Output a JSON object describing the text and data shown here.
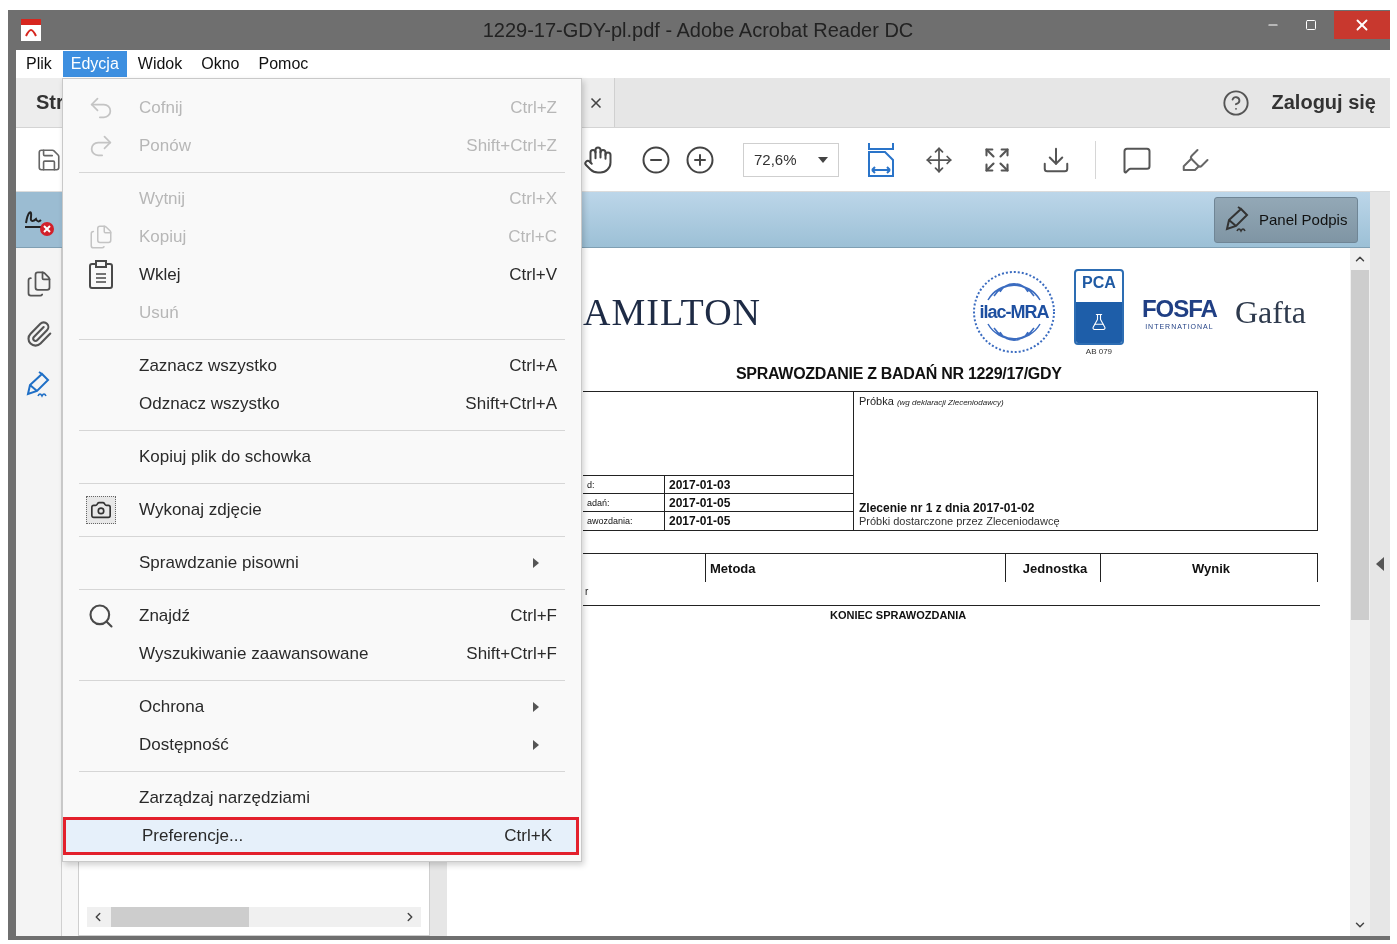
{
  "window": {
    "title": "1229-17-GDY-pl.pdf - Adobe Acrobat Reader DC"
  },
  "menu_bar": [
    {
      "label": "Plik",
      "selected": false
    },
    {
      "label": "Edycja",
      "selected": true
    },
    {
      "label": "Widok",
      "selected": false
    },
    {
      "label": "Okno",
      "selected": false
    },
    {
      "label": "Pomoc",
      "selected": false
    }
  ],
  "tab": {
    "label": "Str"
  },
  "account": {
    "label": "Zaloguj się"
  },
  "toolbar": {
    "zoom": "72,6%"
  },
  "sign_bar": {
    "button": "Panel Podpis"
  },
  "document": {
    "company": "AMILTON",
    "logos": [
      {
        "kind": "ilac",
        "text": "ilac-MRA"
      },
      {
        "kind": "pca",
        "text": "PCA",
        "caption": "AB 079"
      },
      {
        "kind": "fosfa",
        "text": "FOSFA",
        "subtitle": "INTERNATIONAL"
      },
      {
        "kind": "gafta",
        "text": "Gafta"
      }
    ],
    "title": "SPRAWOZDANIE Z BADAŃ NR 1229/17/GDY",
    "info_rows": [
      {
        "label": "d:",
        "value": "2017-01-03"
      },
      {
        "label": "adań:",
        "value": "2017-01-05"
      },
      {
        "label": "awozdania:",
        "value": "2017-01-05"
      }
    ],
    "sample_label": "Próbka",
    "sample_note": "(wg deklaracji Zleceniodawcy)",
    "order": "Zlecenie nr 1 z dnia 2017-01-02",
    "delivery": "Próbki dostarczone przez Zleceniodawcę",
    "results_columns": [
      "Metoda",
      "Jednostka",
      "Wynik"
    ],
    "results_row": "r",
    "end": "KONIEC SPRAWOZDANIA"
  },
  "edit_menu": {
    "items": [
      {
        "kind": "command",
        "label": "Cofnij",
        "shortcut": "Ctrl+Z",
        "disabled": true,
        "selected": false
      },
      {
        "kind": "command",
        "label": "Ponów",
        "shortcut": "Shift+Ctrl+Z",
        "disabled": true,
        "selected": false
      },
      {
        "kind": "separator"
      },
      {
        "kind": "command",
        "label": "Wytnij",
        "shortcut": "Ctrl+X",
        "disabled": true,
        "selected": false
      },
      {
        "kind": "command",
        "label": "Kopiuj",
        "shortcut": "Ctrl+C",
        "disabled": true,
        "selected": false
      },
      {
        "kind": "command",
        "label": "Wklej",
        "shortcut": "Ctrl+V",
        "disabled": false,
        "selected": false
      },
      {
        "kind": "command",
        "label": "Usuń",
        "disabled": true,
        "selected": false
      },
      {
        "kind": "separator"
      },
      {
        "kind": "command",
        "label": "Zaznacz wszystko",
        "shortcut": "Ctrl+A",
        "disabled": false,
        "selected": false
      },
      {
        "kind": "command",
        "label": "Odznacz wszystko",
        "shortcut": "Shift+Ctrl+A",
        "disabled": false,
        "selected": false
      },
      {
        "kind": "separator"
      },
      {
        "kind": "command",
        "label": "Kopiuj plik do schowka",
        "disabled": false,
        "selected": false
      },
      {
        "kind": "separator"
      },
      {
        "kind": "command",
        "label": "Wykonaj zdjęcie",
        "disabled": false,
        "selected": false
      },
      {
        "kind": "separator"
      },
      {
        "kind": "submenu",
        "label": "Sprawdzanie pisowni",
        "disabled": false,
        "selected": false
      },
      {
        "kind": "separator"
      },
      {
        "kind": "command",
        "label": "Znajdź",
        "shortcut": "Ctrl+F",
        "disabled": false,
        "selected": false
      },
      {
        "kind": "command",
        "label": "Wyszukiwanie zaawansowane",
        "shortcut": "Shift+Ctrl+F",
        "disabled": false,
        "selected": false
      },
      {
        "kind": "separator"
      },
      {
        "kind": "submenu",
        "label": "Ochrona",
        "disabled": false,
        "selected": false
      },
      {
        "kind": "submenu",
        "label": "Dostępność",
        "disabled": false,
        "selected": false
      },
      {
        "kind": "separator"
      },
      {
        "kind": "command",
        "label": "Zarządzaj narzędziami",
        "disabled": false,
        "selected": false
      },
      {
        "kind": "command",
        "label": "Preferencje...",
        "shortcut": "Ctrl+K",
        "disabled": false,
        "selected": true
      }
    ]
  }
}
